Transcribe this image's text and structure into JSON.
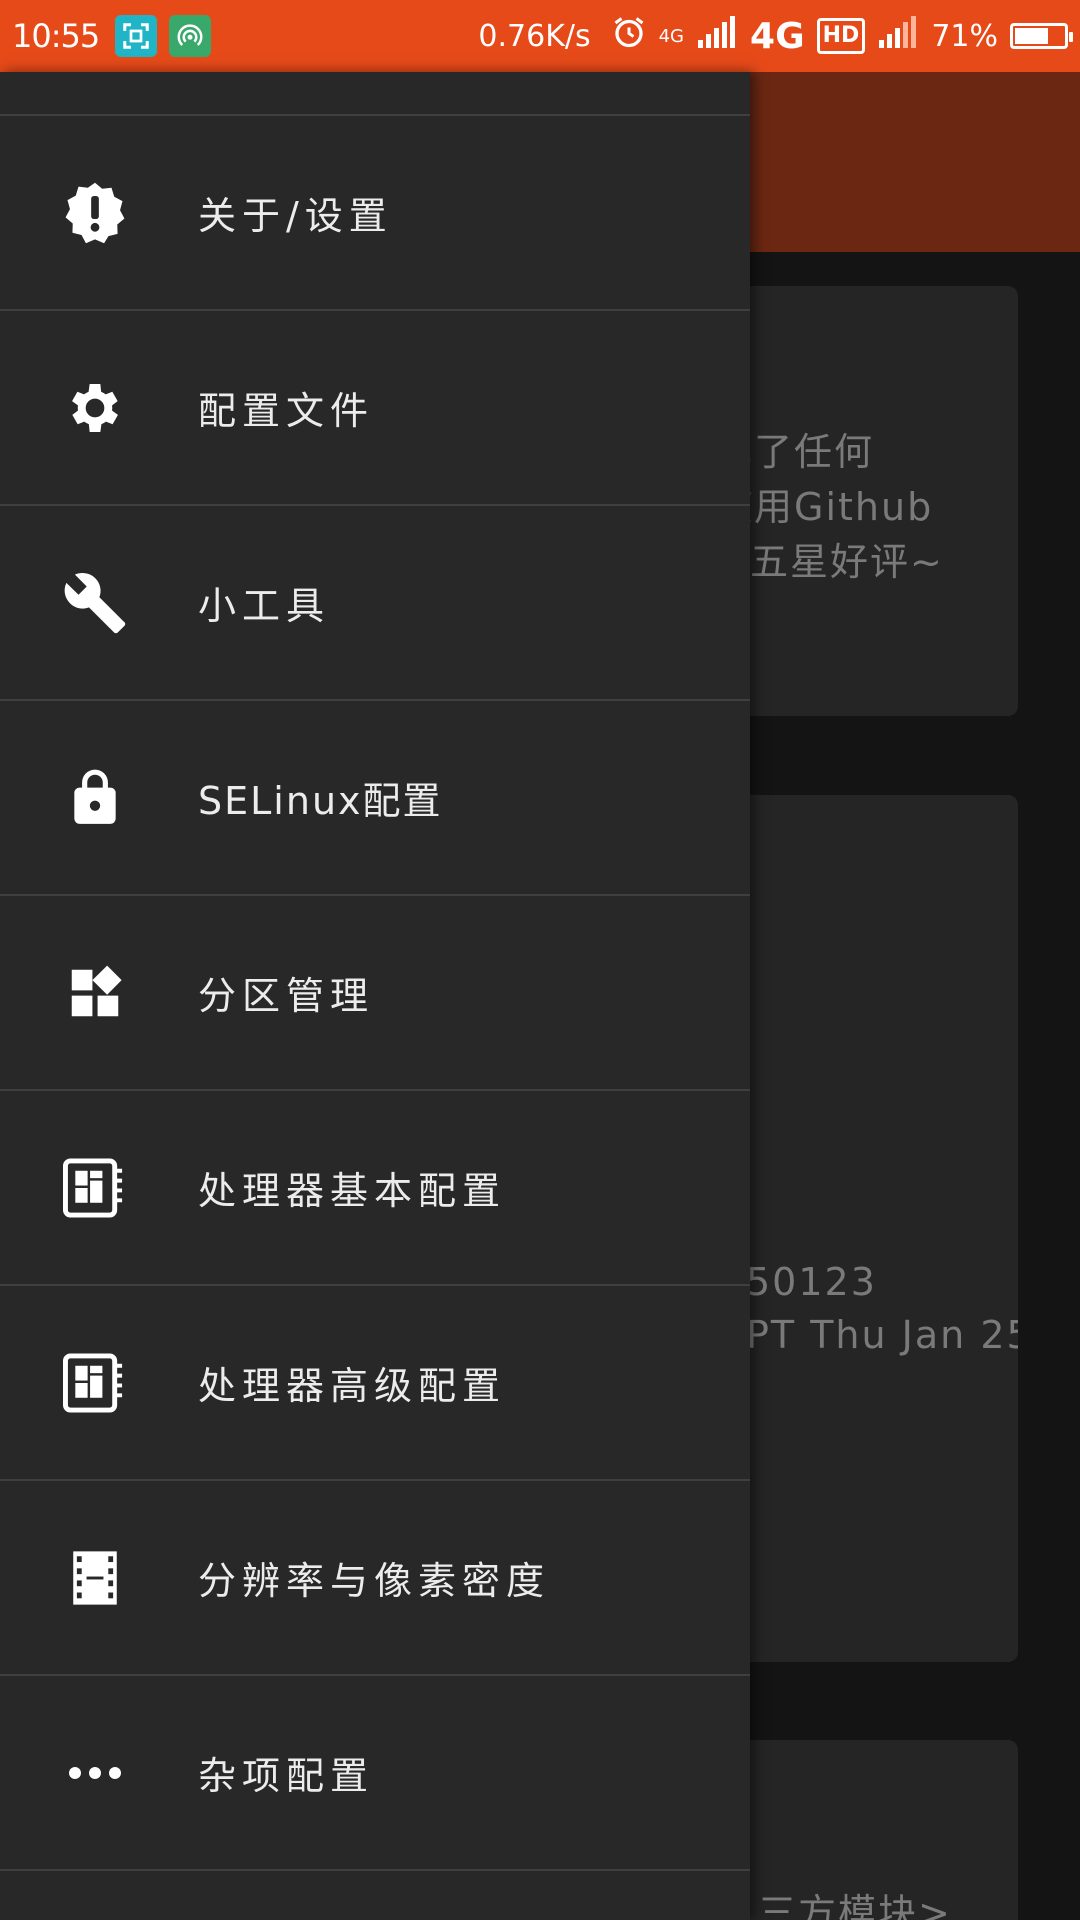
{
  "status_bar": {
    "time": "10:55",
    "net_speed": "0.76K/s",
    "net_type_small": "4G",
    "net_type": "4G",
    "hd": "HD",
    "battery_percent": "71%",
    "battery_level": 71
  },
  "background": {
    "cards": [
      {
        "lines": [
          "发现了任何",
          "以使用Github",
          "五星好评~"
        ]
      },
      {
        "lines": [
          "50123",
          "PT Thu Jan 25"
        ]
      },
      {
        "lines": [
          "三方模块>"
        ]
      }
    ]
  },
  "drawer": {
    "items": [
      {
        "label": "关于/设置",
        "icon": "alert-badge-icon"
      },
      {
        "label": "配置文件",
        "icon": "gear-icon"
      },
      {
        "label": "小工具",
        "icon": "wrench-icon"
      },
      {
        "label": "SELinux配置",
        "icon": "lock-icon"
      },
      {
        "label": "分区管理",
        "icon": "widgets-icon"
      },
      {
        "label": "处理器基本配置",
        "icon": "cpu-icon"
      },
      {
        "label": "处理器高级配置",
        "icon": "cpu-icon"
      },
      {
        "label": "分辨率与像素密度",
        "icon": "film-icon"
      },
      {
        "label": "杂项配置",
        "icon": "more-horiz-icon"
      }
    ]
  }
}
